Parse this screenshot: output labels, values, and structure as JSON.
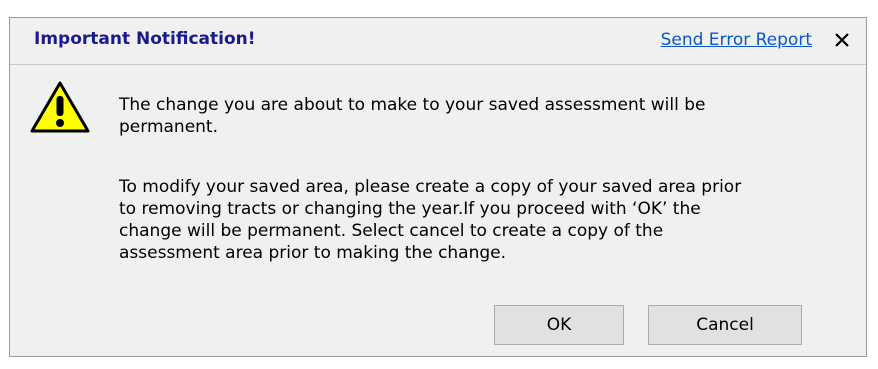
{
  "dialog": {
    "title": "Important Notification!",
    "send_error_report": "Send Error Report",
    "close_symbol": "✕",
    "icon": "warning-icon",
    "message_primary": "The change you are about to make to your saved assessment will be permanent.",
    "message_secondary": "To modify your saved area, please create a copy of your saved area prior to removing tracts or changing the year.If you proceed with ‘OK’ the change will be permanent. Select cancel to create a copy of the assessment area prior to making the change.",
    "ok_label": "OK",
    "cancel_label": "Cancel"
  },
  "colors": {
    "title": "#1a1a8c",
    "link": "#0b57c9",
    "warning_fill": "#ffff00",
    "dialog_bg": "#f0f0f0"
  }
}
